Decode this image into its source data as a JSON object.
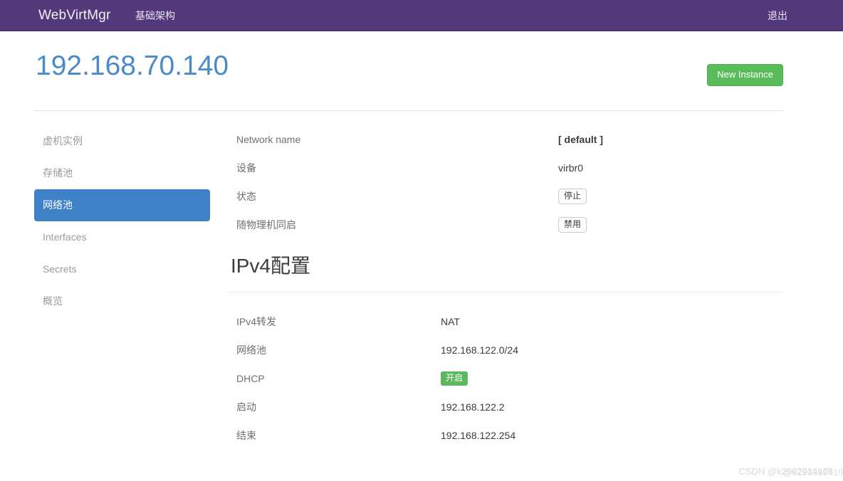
{
  "navbar": {
    "brand": "WebVirtMgr",
    "infrastructure_label": "基础架构",
    "logout_label": "退出"
  },
  "header": {
    "title": "192.168.70.140",
    "new_instance_label": "New Instance",
    "accent_color": "#4a8ac9",
    "button_color": "#5bbc5b",
    "navbar_color": "#53397a"
  },
  "sidebar": {
    "active_color": "#3e81c6",
    "items": [
      {
        "label": "虚机实例",
        "active": false
      },
      {
        "label": "存储池",
        "active": false
      },
      {
        "label": "网络池",
        "active": true
      },
      {
        "label": "Interfaces",
        "active": false
      },
      {
        "label": "Secrets",
        "active": false
      },
      {
        "label": "概览",
        "active": false
      }
    ]
  },
  "network": {
    "rows": [
      {
        "label": "Network name",
        "value": "[ default ]",
        "kind": "bold-text"
      },
      {
        "label": "设备",
        "value": "virbr0",
        "kind": "text"
      },
      {
        "label": "状态",
        "value": "停止",
        "kind": "button"
      },
      {
        "label": "随物理机同启",
        "value": "禁用",
        "kind": "button"
      }
    ]
  },
  "ipv4": {
    "section_title": "IPv4配置",
    "badge_color": "#5cb85c",
    "rows": [
      {
        "label": "IPv4转发",
        "value": "NAT",
        "kind": "text"
      },
      {
        "label": "网络池",
        "value": "192.168.122.0/24",
        "kind": "text"
      },
      {
        "label": "DHCP",
        "value": "开启",
        "kind": "badge"
      },
      {
        "label": "启动",
        "value": "192.168.122.2",
        "kind": "text"
      },
      {
        "label": "结束",
        "value": "192.168.122.254",
        "kind": "text"
      }
    ]
  },
  "watermark": {
    "text": "CSDN @k2902914105",
    "duplicate": "@k2902914105"
  }
}
